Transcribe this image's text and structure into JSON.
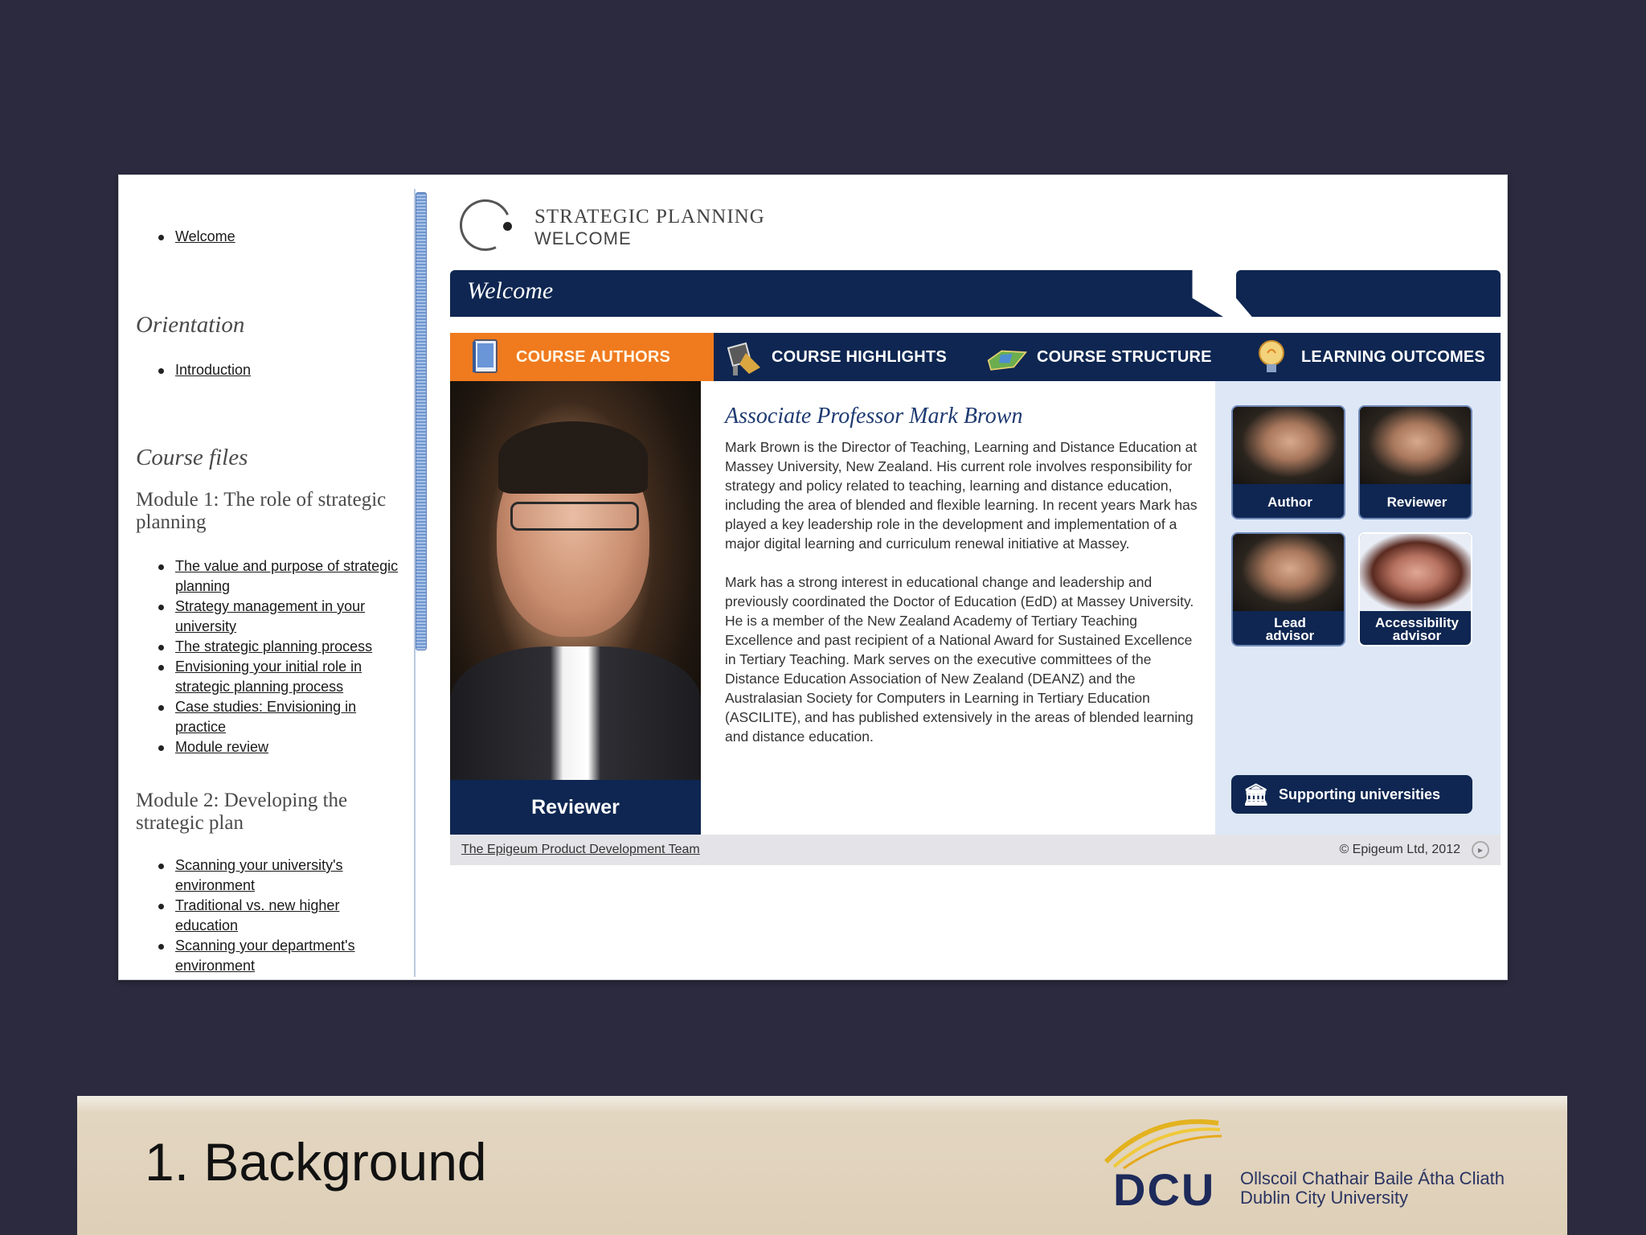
{
  "left_nav": {
    "top_items": [
      "Welcome"
    ],
    "orientation_heading": "Orientation",
    "orientation_items": [
      "Introduction"
    ],
    "course_files_heading": "Course files",
    "module1_heading": "Module 1: The role of strategic planning",
    "module1_items": [
      "The value and purpose of strategic planning",
      "Strategy management in your university",
      "The strategic planning process",
      "Envisioning your initial role in strategic planning process",
      "Case studies: Envisioning in practice",
      "Module review"
    ],
    "module2_heading": "Module 2: Developing the strategic plan",
    "module2_items": [
      "Scanning your university's environment",
      "Traditional vs. new higher education",
      "Scanning your department's environment"
    ]
  },
  "course": {
    "title": "STRATEGIC PLANNING",
    "subtitle": "WELCOME",
    "welcome_bar": "Welcome",
    "tabs": [
      "COURSE AUTHORS",
      "COURSE HIGHLIGHTS",
      "COURSE STRUCTURE",
      "LEARNING OUTCOMES"
    ],
    "active_tab": "COURSE AUTHORS",
    "photo_label": "Reviewer",
    "bio_name": "Associate Professor Mark Brown",
    "bio_p1": "Mark Brown is the Director of Teaching, Learning and Distance Education at Massey University, New Zealand. His current role involves responsibility for strategy and policy related to teaching, learning and distance education, including the area of blended and flexible learning. In recent years Mark has played a key leadership role in the development and implementation of a major digital learning and curriculum renewal initiative at Massey.",
    "bio_p2": "Mark has a strong interest in educational change and leadership and previously coordinated the Doctor of Education (EdD) at Massey University. He is a member of the New Zealand Academy of Tertiary Teaching Excellence and past recipient of a National Award for Sustained Excellence in Tertiary Teaching. Mark serves on the executive committees of the Distance Education Association of New Zealand (DEANZ) and the Australasian Society for Computers in Learning in Tertiary Education (ASCILITE), and has published extensively in the areas of blended learning and distance education.",
    "people": [
      "Author",
      "Reviewer",
      "Lead advisor",
      "Accessibility advisor"
    ],
    "support_button": "Supporting universities",
    "footer_link": "The Epigeum Product Development Team",
    "footer_copyright": "© Epigeum Ltd, 2012"
  },
  "slide": {
    "title": "1. Background",
    "logo_text": "DCU",
    "logo_irish": "Ollscoil Chathair Baile Átha Cliath",
    "logo_english": "Dublin City University"
  },
  "colors": {
    "navy": "#0e2651",
    "orange": "#f07a1e",
    "panel_blue": "#dde7f6",
    "slide_bg": "#2b2a3e"
  }
}
